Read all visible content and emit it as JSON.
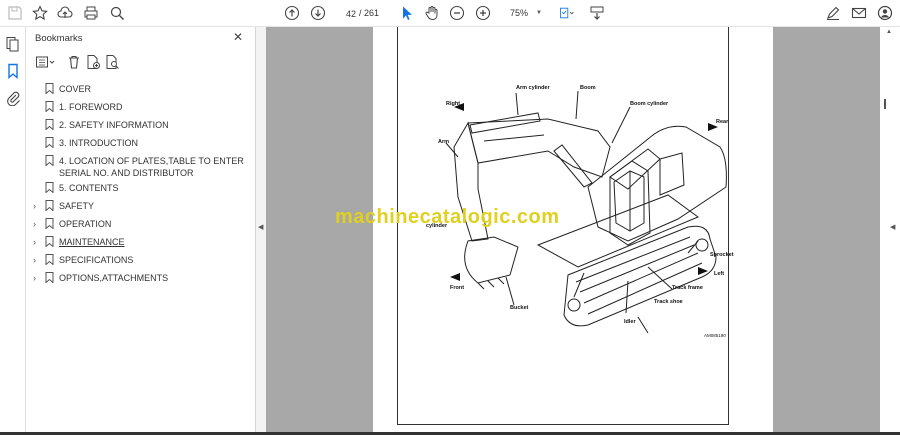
{
  "toolbar": {
    "page_current": "42",
    "page_total": "/ 261",
    "zoom": "75%"
  },
  "bookmarks": {
    "title": "Bookmarks",
    "items": [
      {
        "label": "COVER",
        "expandable": false
      },
      {
        "label": "1. FOREWORD",
        "expandable": false
      },
      {
        "label": "2. SAFETY INFORMATION",
        "expandable": false
      },
      {
        "label": "3. INTRODUCTION",
        "expandable": false
      },
      {
        "label": "4. LOCATION OF PLATES,TABLE TO ENTER SERIAL NO. AND DISTRIBUTOR",
        "expandable": false
      },
      {
        "label": "5. CONTENTS",
        "expandable": false
      },
      {
        "label": "SAFETY",
        "expandable": true
      },
      {
        "label": "OPERATION",
        "expandable": true
      },
      {
        "label": "MAINTENANCE",
        "expandable": true
      },
      {
        "label": "SPECIFICATIONS",
        "expandable": true
      },
      {
        "label": "OPTIONS,ATTACHMENTS",
        "expandable": true
      }
    ]
  },
  "document": {
    "watermark": "machinecatalogic.com",
    "labels": {
      "arm_cylinder": "Arm cylinder",
      "boom": "Boom",
      "boom_cylinder": "Boom cylinder",
      "right": "Right",
      "rear": "Rear",
      "arm": "Arm",
      "cylinder": "cylinder",
      "sprocket": "Sprocket",
      "left": "Left",
      "front": "Front",
      "track_frame": "Track frame",
      "track_shoe": "Track shoe",
      "bucket": "Bucket",
      "idler": "Idler",
      "code": "AM085190"
    }
  },
  "colors": {
    "viewer_bg": "#a8a8a8",
    "watermark": "#e0d020",
    "selected_icon": "#1473e6"
  }
}
